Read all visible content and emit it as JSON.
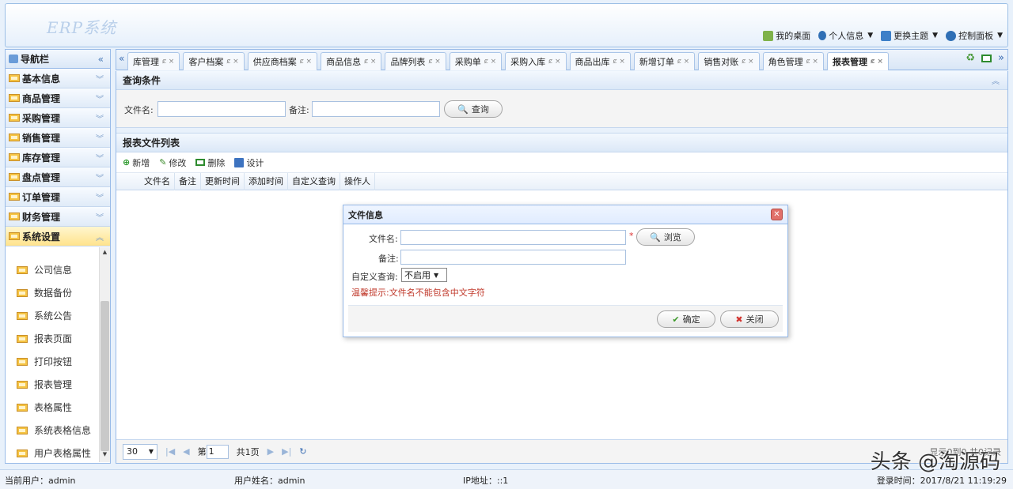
{
  "app": {
    "logo": "ERP系统"
  },
  "topnav": {
    "desktop": "我的桌面",
    "profile": "个人信息",
    "theme": "更换主题",
    "panel": "控制面板"
  },
  "sidebar": {
    "title": "导航栏",
    "sections": [
      "基本信息",
      "商品管理",
      "采购管理",
      "销售管理",
      "库存管理",
      "盘点管理",
      "订单管理",
      "财务管理",
      "系统设置"
    ],
    "sub_items": [
      "公司信息",
      "数据备份",
      "系统公告",
      "报表页面",
      "打印按钮",
      "报表管理",
      "表格属性",
      "系统表格信息",
      "用户表格属性"
    ]
  },
  "tabs": [
    "库管理",
    "客户档案",
    "供应商档案",
    "商品信息",
    "品牌列表",
    "采购单",
    "采购入库",
    "商品出库",
    "新增订单",
    "销售对账",
    "角色管理",
    "报表管理"
  ],
  "query": {
    "title": "查询条件",
    "filename_label": "文件名:",
    "remark_label": "备注:",
    "search_btn": "查询"
  },
  "list": {
    "title": "报表文件列表",
    "toolbar": {
      "add": "新增",
      "edit": "修改",
      "delete": "删除",
      "design": "设计"
    },
    "columns": [
      "文件名",
      "备注",
      "更新时间",
      "添加时间",
      "自定义查询",
      "操作人"
    ]
  },
  "pager": {
    "page_size": "30",
    "page_prefix": "第",
    "page_value": "1",
    "page_suffix": "共1页",
    "info": "显示0到0,共0记录"
  },
  "dialog": {
    "title": "文件信息",
    "filename_label": "文件名:",
    "required_mark": "*",
    "browse_btn": "浏览",
    "remark_label": "备注:",
    "custom_query_label": "自定义查询:",
    "custom_query_value": "不启用",
    "warning": "温馨提示:文件名不能包含中文字符",
    "ok_btn": "确定",
    "close_btn": "关闭"
  },
  "footer": {
    "current_user": "当前用户：admin",
    "user_name": "用户姓名：admin",
    "ip": "IP地址：::1",
    "login_time": "登录时间：2017/8/21 11:19:29"
  },
  "watermark": "头条 @淘源码",
  "colors": {
    "accent": "#99bbe8",
    "warn": "#c0392b",
    "active_section": "#ffe38c"
  }
}
